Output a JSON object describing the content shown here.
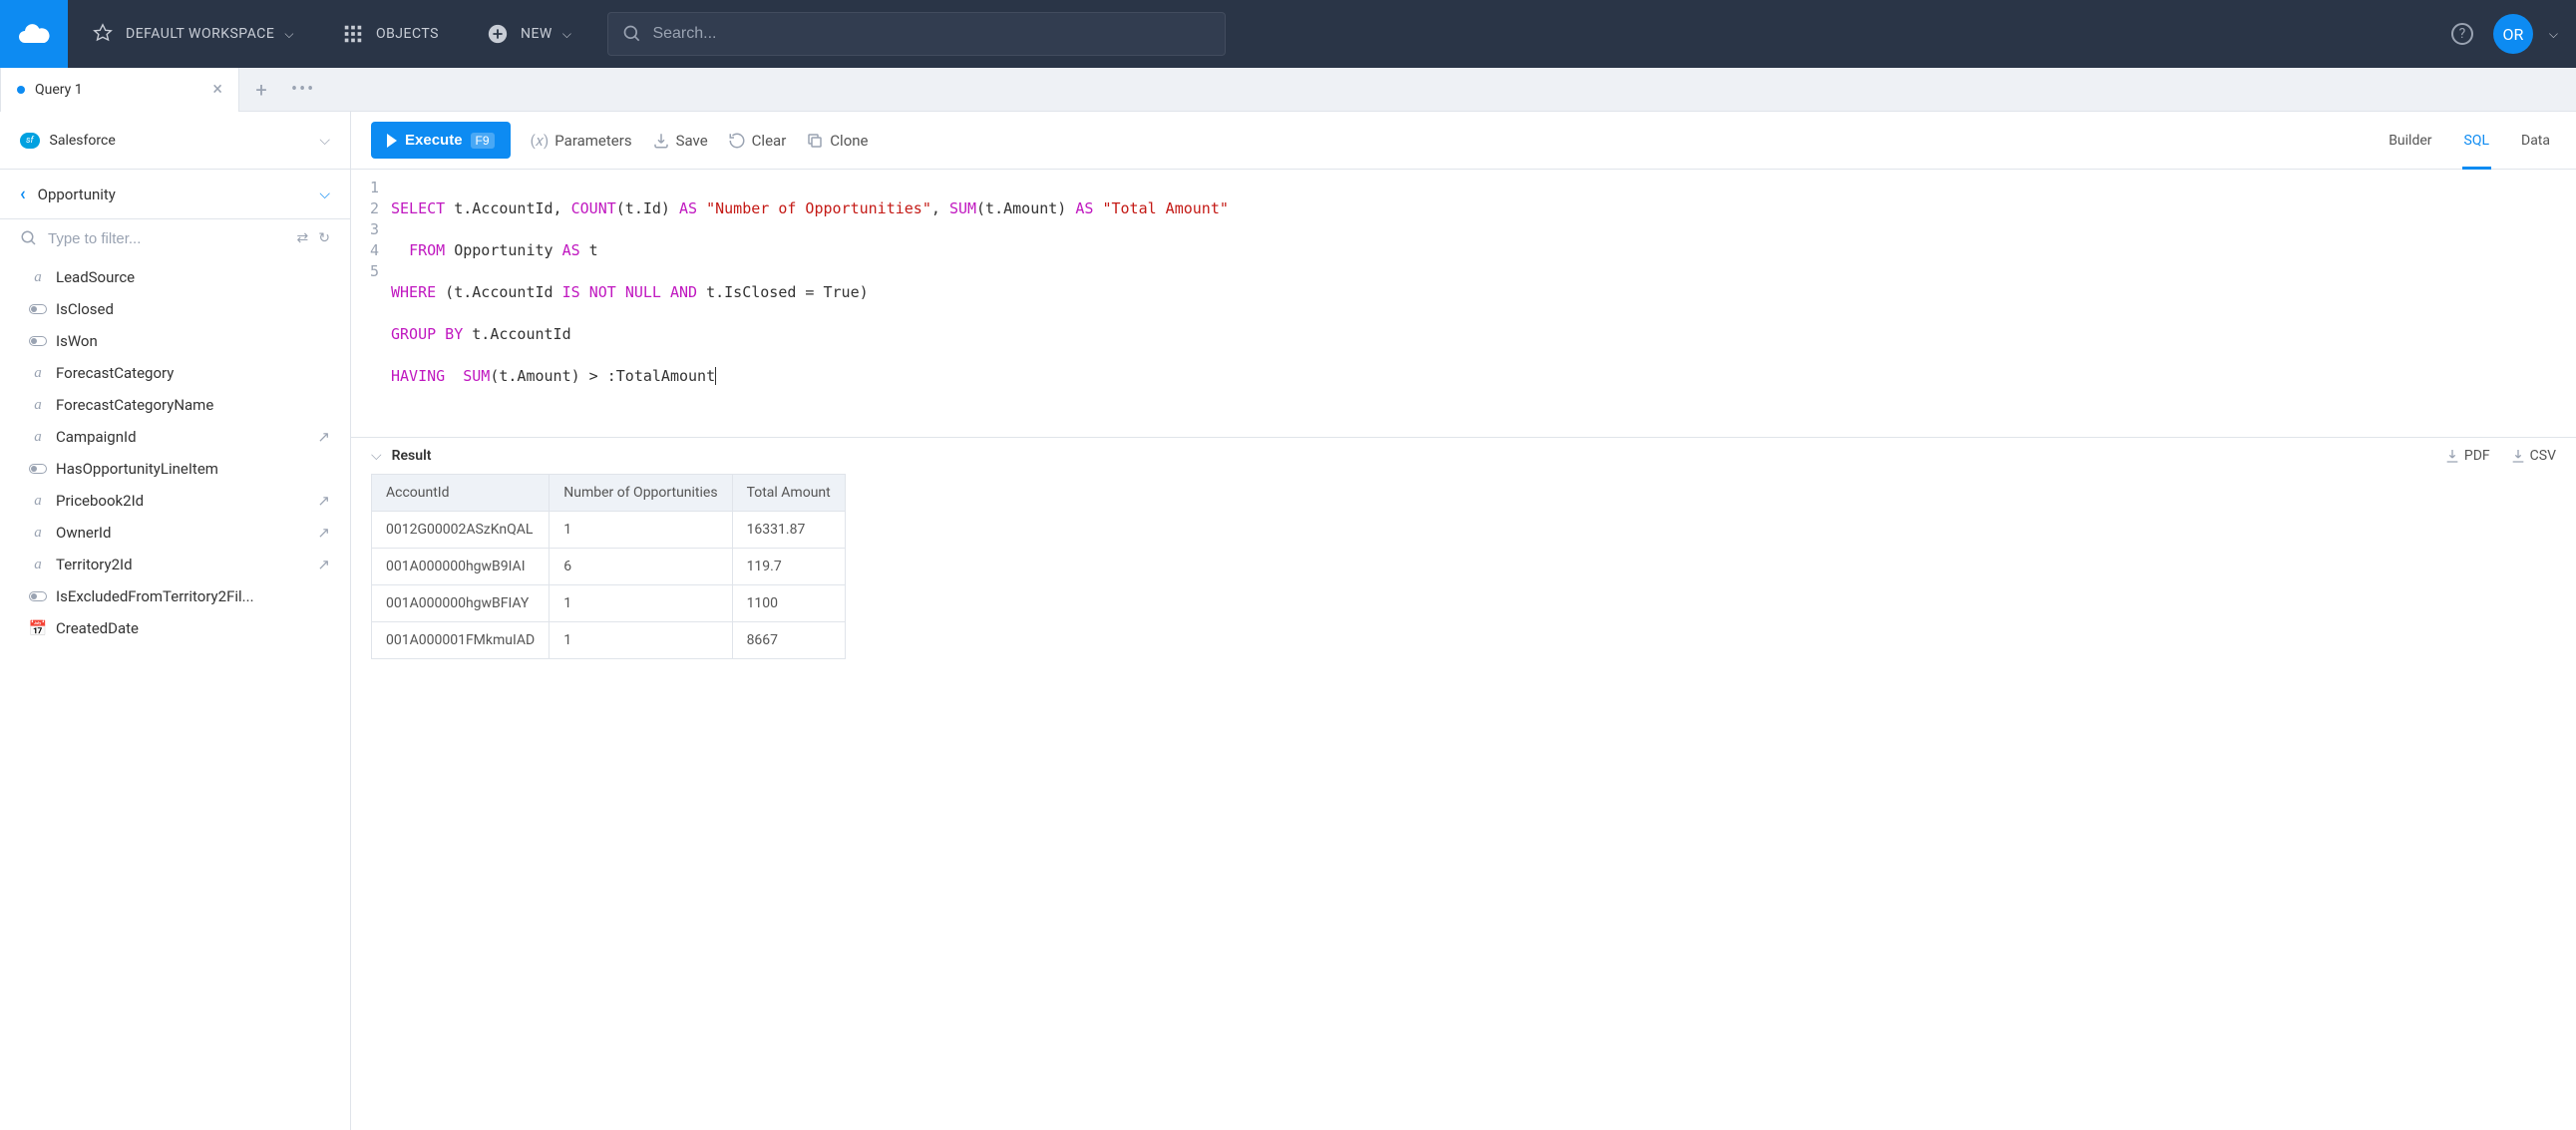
{
  "nav": {
    "workspace": "DEFAULT WORKSPACE",
    "objects": "OBJECTS",
    "new": "NEW",
    "search_placeholder": "Search...",
    "avatar": "OR"
  },
  "tabs": {
    "active": "Query 1"
  },
  "connection": {
    "name": "Salesforce"
  },
  "toolbar": {
    "execute": "Execute",
    "execute_shortcut": "F9",
    "parameters": "Parameters",
    "save": "Save",
    "clear": "Clear",
    "clone": "Clone"
  },
  "views": {
    "builder": "Builder",
    "sql": "SQL",
    "data": "Data"
  },
  "sidebar": {
    "breadcrumb": "Opportunity",
    "filter_placeholder": "Type to filter...",
    "fields": [
      {
        "icon": "text",
        "label": "LeadSource",
        "ext": false
      },
      {
        "icon": "toggle",
        "label": "IsClosed",
        "ext": false
      },
      {
        "icon": "toggle",
        "label": "IsWon",
        "ext": false
      },
      {
        "icon": "text",
        "label": "ForecastCategory",
        "ext": false
      },
      {
        "icon": "text",
        "label": "ForecastCategoryName",
        "ext": false
      },
      {
        "icon": "text",
        "label": "CampaignId",
        "ext": true
      },
      {
        "icon": "toggle",
        "label": "HasOpportunityLineItem",
        "ext": false
      },
      {
        "icon": "text",
        "label": "Pricebook2Id",
        "ext": true
      },
      {
        "icon": "text",
        "label": "OwnerId",
        "ext": true
      },
      {
        "icon": "text",
        "label": "Territory2Id",
        "ext": true
      },
      {
        "icon": "toggle",
        "label": "IsExcludedFromTerritory2Fil...",
        "ext": false
      },
      {
        "icon": "cal",
        "label": "CreatedDate",
        "ext": false
      }
    ]
  },
  "sql": {
    "line1": {
      "a": "SELECT",
      "b": " t.AccountId, ",
      "c": "COUNT",
      "d": "(t.Id) ",
      "e": "AS",
      "f": " ",
      "g": "\"Number of Opportunities\"",
      "h": ", ",
      "i": "SUM",
      "j": "(t.Amount) ",
      "k": "AS",
      "l": " ",
      "m": "\"Total Amount\""
    },
    "line2": {
      "a": "  ",
      "b": "FROM",
      "c": " Opportunity ",
      "d": "AS",
      "e": " t"
    },
    "line3": {
      "a": "WHERE",
      "b": " (t.AccountId ",
      "c": "IS",
      "d": " ",
      "e": "NOT",
      "f": " ",
      "g": "NULL",
      "h": " ",
      "i": "AND",
      "j": " t.IsClosed = True)"
    },
    "line4": {
      "a": "GROUP BY",
      "b": " t.AccountId"
    },
    "line5": {
      "a": "HAVING",
      "b": "  ",
      "c": "SUM",
      "d": "(t.Amount) > :TotalAmount"
    }
  },
  "result": {
    "title": "Result",
    "pdf": "PDF",
    "csv": "CSV",
    "columns": [
      "AccountId",
      "Number of Opportunities",
      "Total Amount"
    ],
    "rows": [
      [
        "0012G00002ASzKnQAL",
        "1",
        "16331.87"
      ],
      [
        "001A000000hgwB9IAI",
        "6",
        "119.7"
      ],
      [
        "001A000000hgwBFIAY",
        "1",
        "1100"
      ],
      [
        "001A000001FMkmuIAD",
        "1",
        "8667"
      ]
    ]
  }
}
